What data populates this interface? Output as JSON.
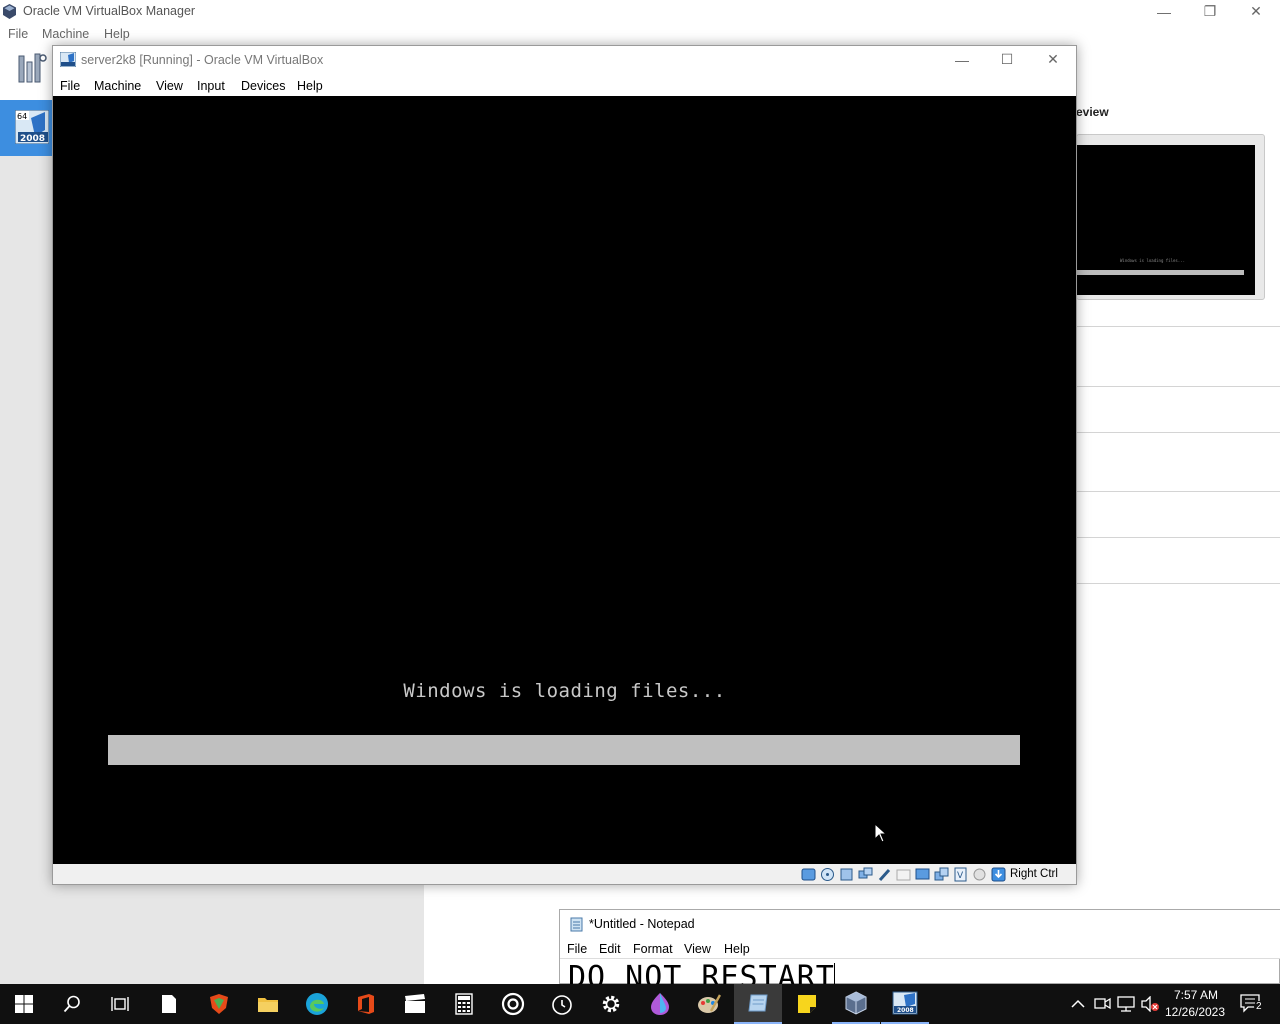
{
  "manager": {
    "title": "Oracle VM VirtualBox Manager",
    "menu": [
      "File",
      "Machine",
      "Help"
    ],
    "preview_label": "eview",
    "preview_text": "Windows is loading files..."
  },
  "vm_window": {
    "title": "server2k8 [Running] - Oracle VM VirtualBox",
    "menu": [
      "File",
      "Machine",
      "View",
      "Input",
      "Devices",
      "Help"
    ],
    "screen_text": "Windows is loading files...",
    "host_key": "Right Ctrl"
  },
  "notepad": {
    "title": "*Untitled - Notepad",
    "menu": [
      "File",
      "Edit",
      "Format",
      "View",
      "Help"
    ],
    "content": "DO NOT RESTART"
  },
  "taskbar": {
    "time": "7:57 AM",
    "date": "12/26/2023",
    "notification_count": "2"
  },
  "colors": {
    "accent": "#3d8ee0",
    "taskbar": "#101010"
  }
}
